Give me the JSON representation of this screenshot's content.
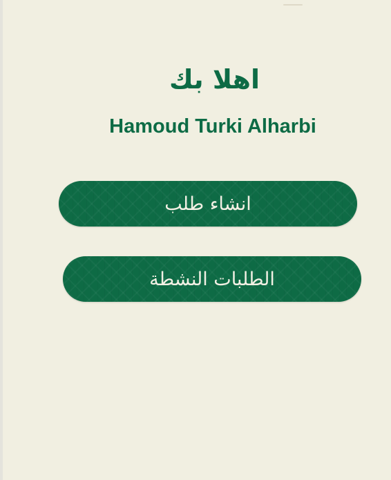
{
  "welcome": {
    "greeting": "اهلا بك",
    "user_name": "Hamoud Turki Alharbi"
  },
  "actions": {
    "create_request_label": "انشاء طلب",
    "active_requests_label": "الطلبات النشطة"
  },
  "colors": {
    "background": "#f1efe1",
    "brand_green": "#0e6b45",
    "button_text": "#f2f0e4"
  }
}
